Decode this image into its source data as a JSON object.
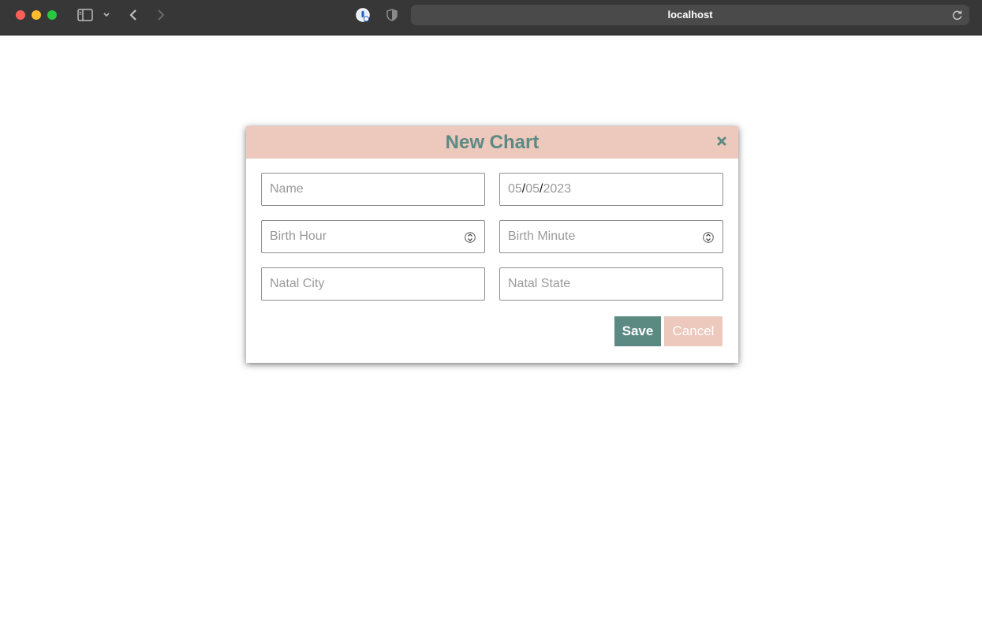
{
  "browser": {
    "address": "localhost"
  },
  "modal": {
    "title": "New Chart",
    "fields": {
      "name_placeholder": "Name",
      "date_month": "05",
      "date_day": "05",
      "date_year": "2023",
      "date_separator": "/",
      "birth_hour_placeholder": "Birth Hour",
      "birth_minute_placeholder": "Birth Minute",
      "natal_city_placeholder": "Natal City",
      "natal_state_placeholder": "Natal State"
    },
    "buttons": {
      "save_label": "Save",
      "cancel_label": "Cancel"
    }
  },
  "colors": {
    "accent": "#5b8a83",
    "header_bg": "#ecc8bd",
    "chrome_bg": "#373737"
  },
  "icons": {
    "close": "close-icon",
    "stepper": "stepper-icon",
    "back": "chevron-left-icon",
    "forward": "chevron-right-icon",
    "sidebar": "sidebar-icon",
    "reload": "reload-icon"
  }
}
